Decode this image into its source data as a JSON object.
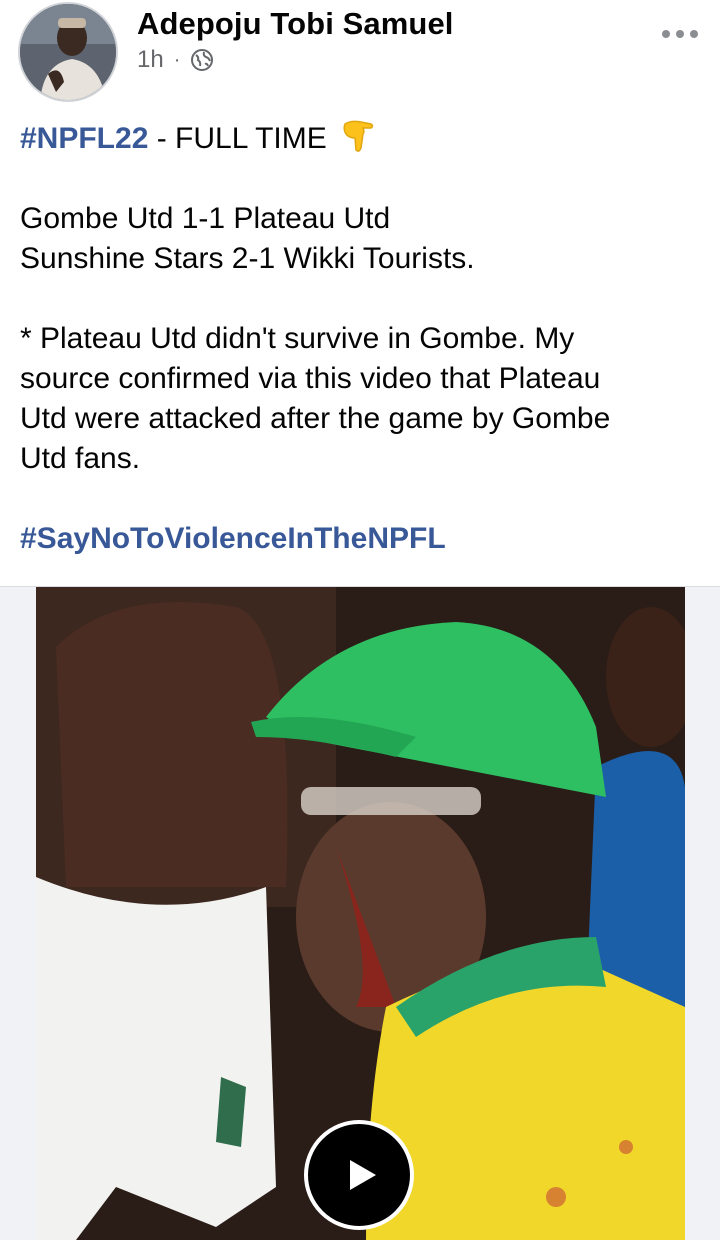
{
  "post": {
    "author": "Adepoju Tobi Samuel",
    "time": "1h",
    "separator": "·",
    "privacy_icon": "globe-icon",
    "more_icon": "more-horizontal-icon",
    "hashtag_title": "#NPFL22",
    "title_rest": " - FULL TIME",
    "title_emoji": "pointing-down-hand-icon",
    "results": [
      "Gombe Utd 1-1 Plateau Utd",
      "Sunshine Stars 2-1 Wikki Tourists."
    ],
    "paragraph_lines": [
      "* Plateau Utd didn't survive in Gombe. My",
      "source confirmed via this video that Plateau",
      "Utd were attacked after the game by Gombe",
      "Utd fans."
    ],
    "hashtag_footer": "#SayNoToViolenceInTheNPFL"
  },
  "media": {
    "type": "video",
    "play_icon": "play-icon"
  },
  "colors": {
    "hashtag": "#385898",
    "text": "#050505",
    "secondary": "#65676b"
  }
}
